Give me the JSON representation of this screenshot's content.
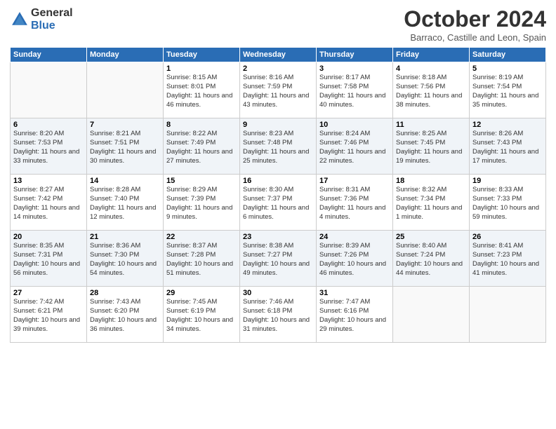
{
  "header": {
    "logo_general": "General",
    "logo_blue": "Blue",
    "month_title": "October 2024",
    "location": "Barraco, Castille and Leon, Spain"
  },
  "weekdays": [
    "Sunday",
    "Monday",
    "Tuesday",
    "Wednesday",
    "Thursday",
    "Friday",
    "Saturday"
  ],
  "weeks": [
    [
      {
        "day": "",
        "sunrise": "",
        "sunset": "",
        "daylight": ""
      },
      {
        "day": "",
        "sunrise": "",
        "sunset": "",
        "daylight": ""
      },
      {
        "day": "1",
        "sunrise": "Sunrise: 8:15 AM",
        "sunset": "Sunset: 8:01 PM",
        "daylight": "Daylight: 11 hours and 46 minutes."
      },
      {
        "day": "2",
        "sunrise": "Sunrise: 8:16 AM",
        "sunset": "Sunset: 7:59 PM",
        "daylight": "Daylight: 11 hours and 43 minutes."
      },
      {
        "day": "3",
        "sunrise": "Sunrise: 8:17 AM",
        "sunset": "Sunset: 7:58 PM",
        "daylight": "Daylight: 11 hours and 40 minutes."
      },
      {
        "day": "4",
        "sunrise": "Sunrise: 8:18 AM",
        "sunset": "Sunset: 7:56 PM",
        "daylight": "Daylight: 11 hours and 38 minutes."
      },
      {
        "day": "5",
        "sunrise": "Sunrise: 8:19 AM",
        "sunset": "Sunset: 7:54 PM",
        "daylight": "Daylight: 11 hours and 35 minutes."
      }
    ],
    [
      {
        "day": "6",
        "sunrise": "Sunrise: 8:20 AM",
        "sunset": "Sunset: 7:53 PM",
        "daylight": "Daylight: 11 hours and 33 minutes."
      },
      {
        "day": "7",
        "sunrise": "Sunrise: 8:21 AM",
        "sunset": "Sunset: 7:51 PM",
        "daylight": "Daylight: 11 hours and 30 minutes."
      },
      {
        "day": "8",
        "sunrise": "Sunrise: 8:22 AM",
        "sunset": "Sunset: 7:49 PM",
        "daylight": "Daylight: 11 hours and 27 minutes."
      },
      {
        "day": "9",
        "sunrise": "Sunrise: 8:23 AM",
        "sunset": "Sunset: 7:48 PM",
        "daylight": "Daylight: 11 hours and 25 minutes."
      },
      {
        "day": "10",
        "sunrise": "Sunrise: 8:24 AM",
        "sunset": "Sunset: 7:46 PM",
        "daylight": "Daylight: 11 hours and 22 minutes."
      },
      {
        "day": "11",
        "sunrise": "Sunrise: 8:25 AM",
        "sunset": "Sunset: 7:45 PM",
        "daylight": "Daylight: 11 hours and 19 minutes."
      },
      {
        "day": "12",
        "sunrise": "Sunrise: 8:26 AM",
        "sunset": "Sunset: 7:43 PM",
        "daylight": "Daylight: 11 hours and 17 minutes."
      }
    ],
    [
      {
        "day": "13",
        "sunrise": "Sunrise: 8:27 AM",
        "sunset": "Sunset: 7:42 PM",
        "daylight": "Daylight: 11 hours and 14 minutes."
      },
      {
        "day": "14",
        "sunrise": "Sunrise: 8:28 AM",
        "sunset": "Sunset: 7:40 PM",
        "daylight": "Daylight: 11 hours and 12 minutes."
      },
      {
        "day": "15",
        "sunrise": "Sunrise: 8:29 AM",
        "sunset": "Sunset: 7:39 PM",
        "daylight": "Daylight: 11 hours and 9 minutes."
      },
      {
        "day": "16",
        "sunrise": "Sunrise: 8:30 AM",
        "sunset": "Sunset: 7:37 PM",
        "daylight": "Daylight: 11 hours and 6 minutes."
      },
      {
        "day": "17",
        "sunrise": "Sunrise: 8:31 AM",
        "sunset": "Sunset: 7:36 PM",
        "daylight": "Daylight: 11 hours and 4 minutes."
      },
      {
        "day": "18",
        "sunrise": "Sunrise: 8:32 AM",
        "sunset": "Sunset: 7:34 PM",
        "daylight": "Daylight: 11 hours and 1 minute."
      },
      {
        "day": "19",
        "sunrise": "Sunrise: 8:33 AM",
        "sunset": "Sunset: 7:33 PM",
        "daylight": "Daylight: 10 hours and 59 minutes."
      }
    ],
    [
      {
        "day": "20",
        "sunrise": "Sunrise: 8:35 AM",
        "sunset": "Sunset: 7:31 PM",
        "daylight": "Daylight: 10 hours and 56 minutes."
      },
      {
        "day": "21",
        "sunrise": "Sunrise: 8:36 AM",
        "sunset": "Sunset: 7:30 PM",
        "daylight": "Daylight: 10 hours and 54 minutes."
      },
      {
        "day": "22",
        "sunrise": "Sunrise: 8:37 AM",
        "sunset": "Sunset: 7:28 PM",
        "daylight": "Daylight: 10 hours and 51 minutes."
      },
      {
        "day": "23",
        "sunrise": "Sunrise: 8:38 AM",
        "sunset": "Sunset: 7:27 PM",
        "daylight": "Daylight: 10 hours and 49 minutes."
      },
      {
        "day": "24",
        "sunrise": "Sunrise: 8:39 AM",
        "sunset": "Sunset: 7:26 PM",
        "daylight": "Daylight: 10 hours and 46 minutes."
      },
      {
        "day": "25",
        "sunrise": "Sunrise: 8:40 AM",
        "sunset": "Sunset: 7:24 PM",
        "daylight": "Daylight: 10 hours and 44 minutes."
      },
      {
        "day": "26",
        "sunrise": "Sunrise: 8:41 AM",
        "sunset": "Sunset: 7:23 PM",
        "daylight": "Daylight: 10 hours and 41 minutes."
      }
    ],
    [
      {
        "day": "27",
        "sunrise": "Sunrise: 7:42 AM",
        "sunset": "Sunset: 6:21 PM",
        "daylight": "Daylight: 10 hours and 39 minutes."
      },
      {
        "day": "28",
        "sunrise": "Sunrise: 7:43 AM",
        "sunset": "Sunset: 6:20 PM",
        "daylight": "Daylight: 10 hours and 36 minutes."
      },
      {
        "day": "29",
        "sunrise": "Sunrise: 7:45 AM",
        "sunset": "Sunset: 6:19 PM",
        "daylight": "Daylight: 10 hours and 34 minutes."
      },
      {
        "day": "30",
        "sunrise": "Sunrise: 7:46 AM",
        "sunset": "Sunset: 6:18 PM",
        "daylight": "Daylight: 10 hours and 31 minutes."
      },
      {
        "day": "31",
        "sunrise": "Sunrise: 7:47 AM",
        "sunset": "Sunset: 6:16 PM",
        "daylight": "Daylight: 10 hours and 29 minutes."
      },
      {
        "day": "",
        "sunrise": "",
        "sunset": "",
        "daylight": ""
      },
      {
        "day": "",
        "sunrise": "",
        "sunset": "",
        "daylight": ""
      }
    ]
  ]
}
